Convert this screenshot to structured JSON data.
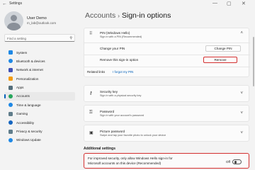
{
  "window": {
    "title": "Settings",
    "back": "←",
    "min": "—",
    "max": "▢",
    "close": "✕"
  },
  "user": {
    "name": "User Demo",
    "email": "m_lab@outlook.com"
  },
  "search": {
    "placeholder": "Find a setting"
  },
  "sidebar": {
    "items": [
      {
        "label": "System",
        "icon": "monitor-icon",
        "color": "#1e88e5",
        "active": false
      },
      {
        "label": "Bluetooth & devices",
        "icon": "bluetooth-icon",
        "color": "#1e88e5",
        "active": false
      },
      {
        "label": "Network & internet",
        "icon": "wifi-icon",
        "color": "#3f51b5",
        "active": false
      },
      {
        "label": "Personalization",
        "icon": "brush-icon",
        "color": "#f39c12",
        "active": false
      },
      {
        "label": "Apps",
        "icon": "apps-icon",
        "color": "#546e7a",
        "active": false
      },
      {
        "label": "Accounts",
        "icon": "person-icon",
        "color": "#26a65b",
        "active": true
      },
      {
        "label": "Time & language",
        "icon": "globe-clock-icon",
        "color": "#1e88e5",
        "active": false
      },
      {
        "label": "Gaming",
        "icon": "gamepad-icon",
        "color": "#607d8b",
        "active": false
      },
      {
        "label": "Accessibility",
        "icon": "accessibility-icon",
        "color": "#1565c0",
        "active": false
      },
      {
        "label": "Privacy & security",
        "icon": "shield-icon",
        "color": "#607d8b",
        "active": false
      },
      {
        "label": "Windows Update",
        "icon": "update-icon",
        "color": "#1e88e5",
        "active": false
      }
    ]
  },
  "breadcrumb": {
    "parent": "Accounts",
    "separator": "›",
    "current": "Sign-in options"
  },
  "pin": {
    "title": "PIN (Windows Hello)",
    "subtitle": "Sign in with a PIN (Recommended)",
    "change_label": "Change your PIN",
    "change_button": "Change PIN",
    "remove_label": "Remove this sign-in option",
    "remove_button": "Remove"
  },
  "related": {
    "label": "Related links",
    "link": "I forgot my PIN"
  },
  "security_key": {
    "title": "Security key",
    "subtitle": "Sign in with a physical security key"
  },
  "password": {
    "title": "Password",
    "subtitle": "Sign in with your account's password"
  },
  "picture_password": {
    "title": "Picture password",
    "subtitle": "Swipe and tap your favorite photo to unlock your device"
  },
  "additional": {
    "title": "Additional settings",
    "line1": "For improved security, only allow Windows Hello sign-in for",
    "line2": "Microsoft accounts on this device (Recommended)",
    "toggle_label": "Off",
    "toggle_on": false
  },
  "colors": {
    "accent": "#005fb8",
    "highlight": "#d32f2f"
  }
}
